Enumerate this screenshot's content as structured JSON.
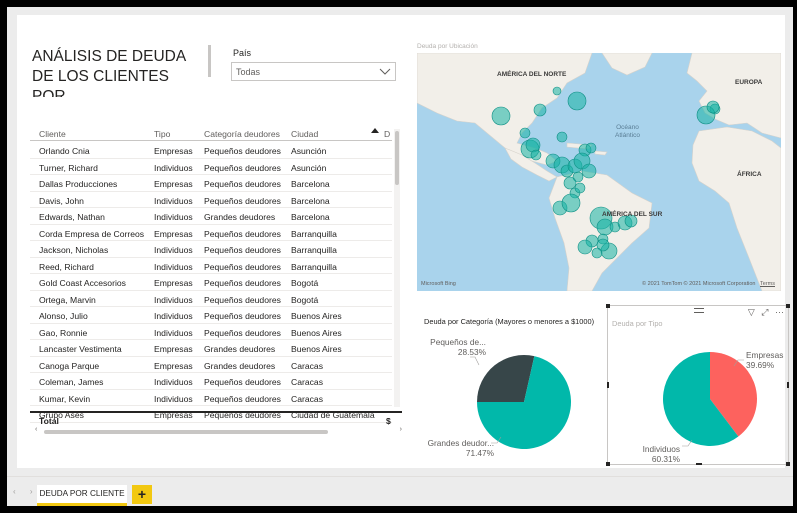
{
  "report": {
    "title": "ANÁLISIS DE DEUDA DE LOS CLIENTES POR",
    "page_tab": "DEUDA POR CLIENTE",
    "add_page": "+"
  },
  "slicer": {
    "label": "País",
    "value": "Todas"
  },
  "table": {
    "columns": [
      "Cliente",
      "Tipo",
      "Categoría deudores",
      "Ciudad",
      "D"
    ],
    "rows": [
      [
        "Orlando Cnia",
        "Empresas",
        "Pequeños deudores",
        "Asunción"
      ],
      [
        "Turner, Richard",
        "Individuos",
        "Pequeños deudores",
        "Asunción"
      ],
      [
        "Dallas Producciones",
        "Empresas",
        "Pequeños deudores",
        "Barcelona"
      ],
      [
        "Davis, John",
        "Individuos",
        "Pequeños deudores",
        "Barcelona"
      ],
      [
        "Edwards, Nathan",
        "Individuos",
        "Grandes deudores",
        "Barcelona"
      ],
      [
        "Corda Empresa de Correos",
        "Empresas",
        "Pequeños deudores",
        "Barranquilla"
      ],
      [
        "Jackson, Nicholas",
        "Individuos",
        "Pequeños deudores",
        "Barranquilla"
      ],
      [
        "Reed, Richard",
        "Individuos",
        "Pequeños deudores",
        "Barranquilla"
      ],
      [
        "Gold Coast Accesorios",
        "Empresas",
        "Pequeños deudores",
        "Bogotá"
      ],
      [
        "Ortega, Marvin",
        "Individuos",
        "Pequeños deudores",
        "Bogotá"
      ],
      [
        "Alonso, Julio",
        "Individuos",
        "Pequeños deudores",
        "Buenos Aires"
      ],
      [
        "Gao, Ronnie",
        "Individuos",
        "Pequeños deudores",
        "Buenos Aires"
      ],
      [
        "Lancaster Vestimenta",
        "Empresas",
        "Grandes deudores",
        "Buenos Aires"
      ],
      [
        "Canoga Parque",
        "Empresas",
        "Grandes deudores",
        "Caracas"
      ],
      [
        "Coleman, James",
        "Individuos",
        "Pequeños deudores",
        "Caracas"
      ],
      [
        "Kumar, Kevin",
        "Individuos",
        "Pequeños deudores",
        "Caracas"
      ],
      [
        "Grupo Ases",
        "Empresas",
        "Pequeños deudores",
        "Ciudad de Guatemala"
      ]
    ],
    "total_label": "Total",
    "total_value": "$"
  },
  "map": {
    "title": "Deuda por Ubicación",
    "labels": {
      "na": "AMÉRICA DEL NORTE",
      "eu": "EUROPA",
      "af": "ÁFRICA",
      "sa": "AMÉRICA DEL SUR",
      "ocean1": "Océano",
      "ocean2": "Atlántico"
    },
    "logo": "Microsoft Bing",
    "copyright": "© 2021 TomTom © 2021 Microsoft Corporation",
    "terms": "Terms",
    "bubble_color": "#16b3a4"
  },
  "pie_categoria": {
    "title": "Deuda por Categoría (Mayores o menores a $1000)",
    "slices": [
      {
        "name": "Pequeños de...",
        "pct_label": "28.53%",
        "value": 28.53,
        "color": "#374649"
      },
      {
        "name": "Grandes deudor...",
        "pct_label": "71.47%",
        "value": 71.47,
        "color": "#01b8aa"
      }
    ]
  },
  "pie_tipo": {
    "title": "Deuda por Tipo",
    "slices": [
      {
        "name": "Empresas",
        "pct_label": "39.69%",
        "value": 39.69,
        "color": "#fd625e"
      },
      {
        "name": "Individuos",
        "pct_label": "60.31%",
        "value": 60.31,
        "color": "#01b8aa"
      }
    ],
    "toolbar": {
      "filter": "▽",
      "focus": "⤢",
      "more": "···"
    }
  }
}
